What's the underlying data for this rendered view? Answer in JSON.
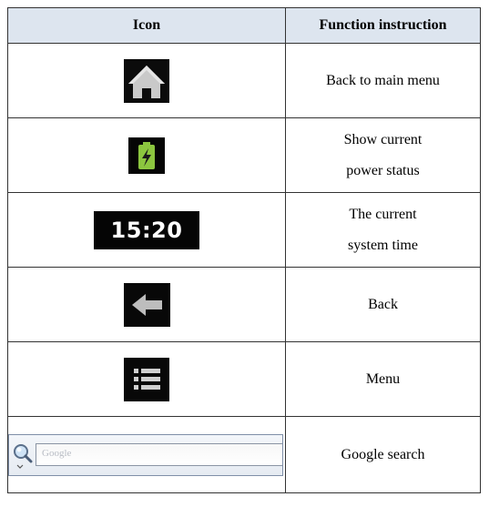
{
  "table": {
    "headers": {
      "icon": "Icon",
      "function": "Function instruction"
    },
    "rows": [
      {
        "icon": "home-icon",
        "lines": [
          "Back to main menu"
        ]
      },
      {
        "icon": "battery-icon",
        "lines": [
          "Show current",
          "power status"
        ]
      },
      {
        "icon": "clock-icon",
        "time": "15:20",
        "lines": [
          "The current",
          "system time"
        ]
      },
      {
        "icon": "back-arrow-icon",
        "lines": [
          "Back"
        ]
      },
      {
        "icon": "menu-icon",
        "lines": [
          "Menu"
        ]
      },
      {
        "icon": "google-search-bar",
        "search_placeholder": "Google",
        "lines": [
          "Google search"
        ]
      }
    ]
  },
  "colors": {
    "header_background": "#dde5ef",
    "battery_green": "#8cc63f",
    "icon_background": "#000000"
  }
}
